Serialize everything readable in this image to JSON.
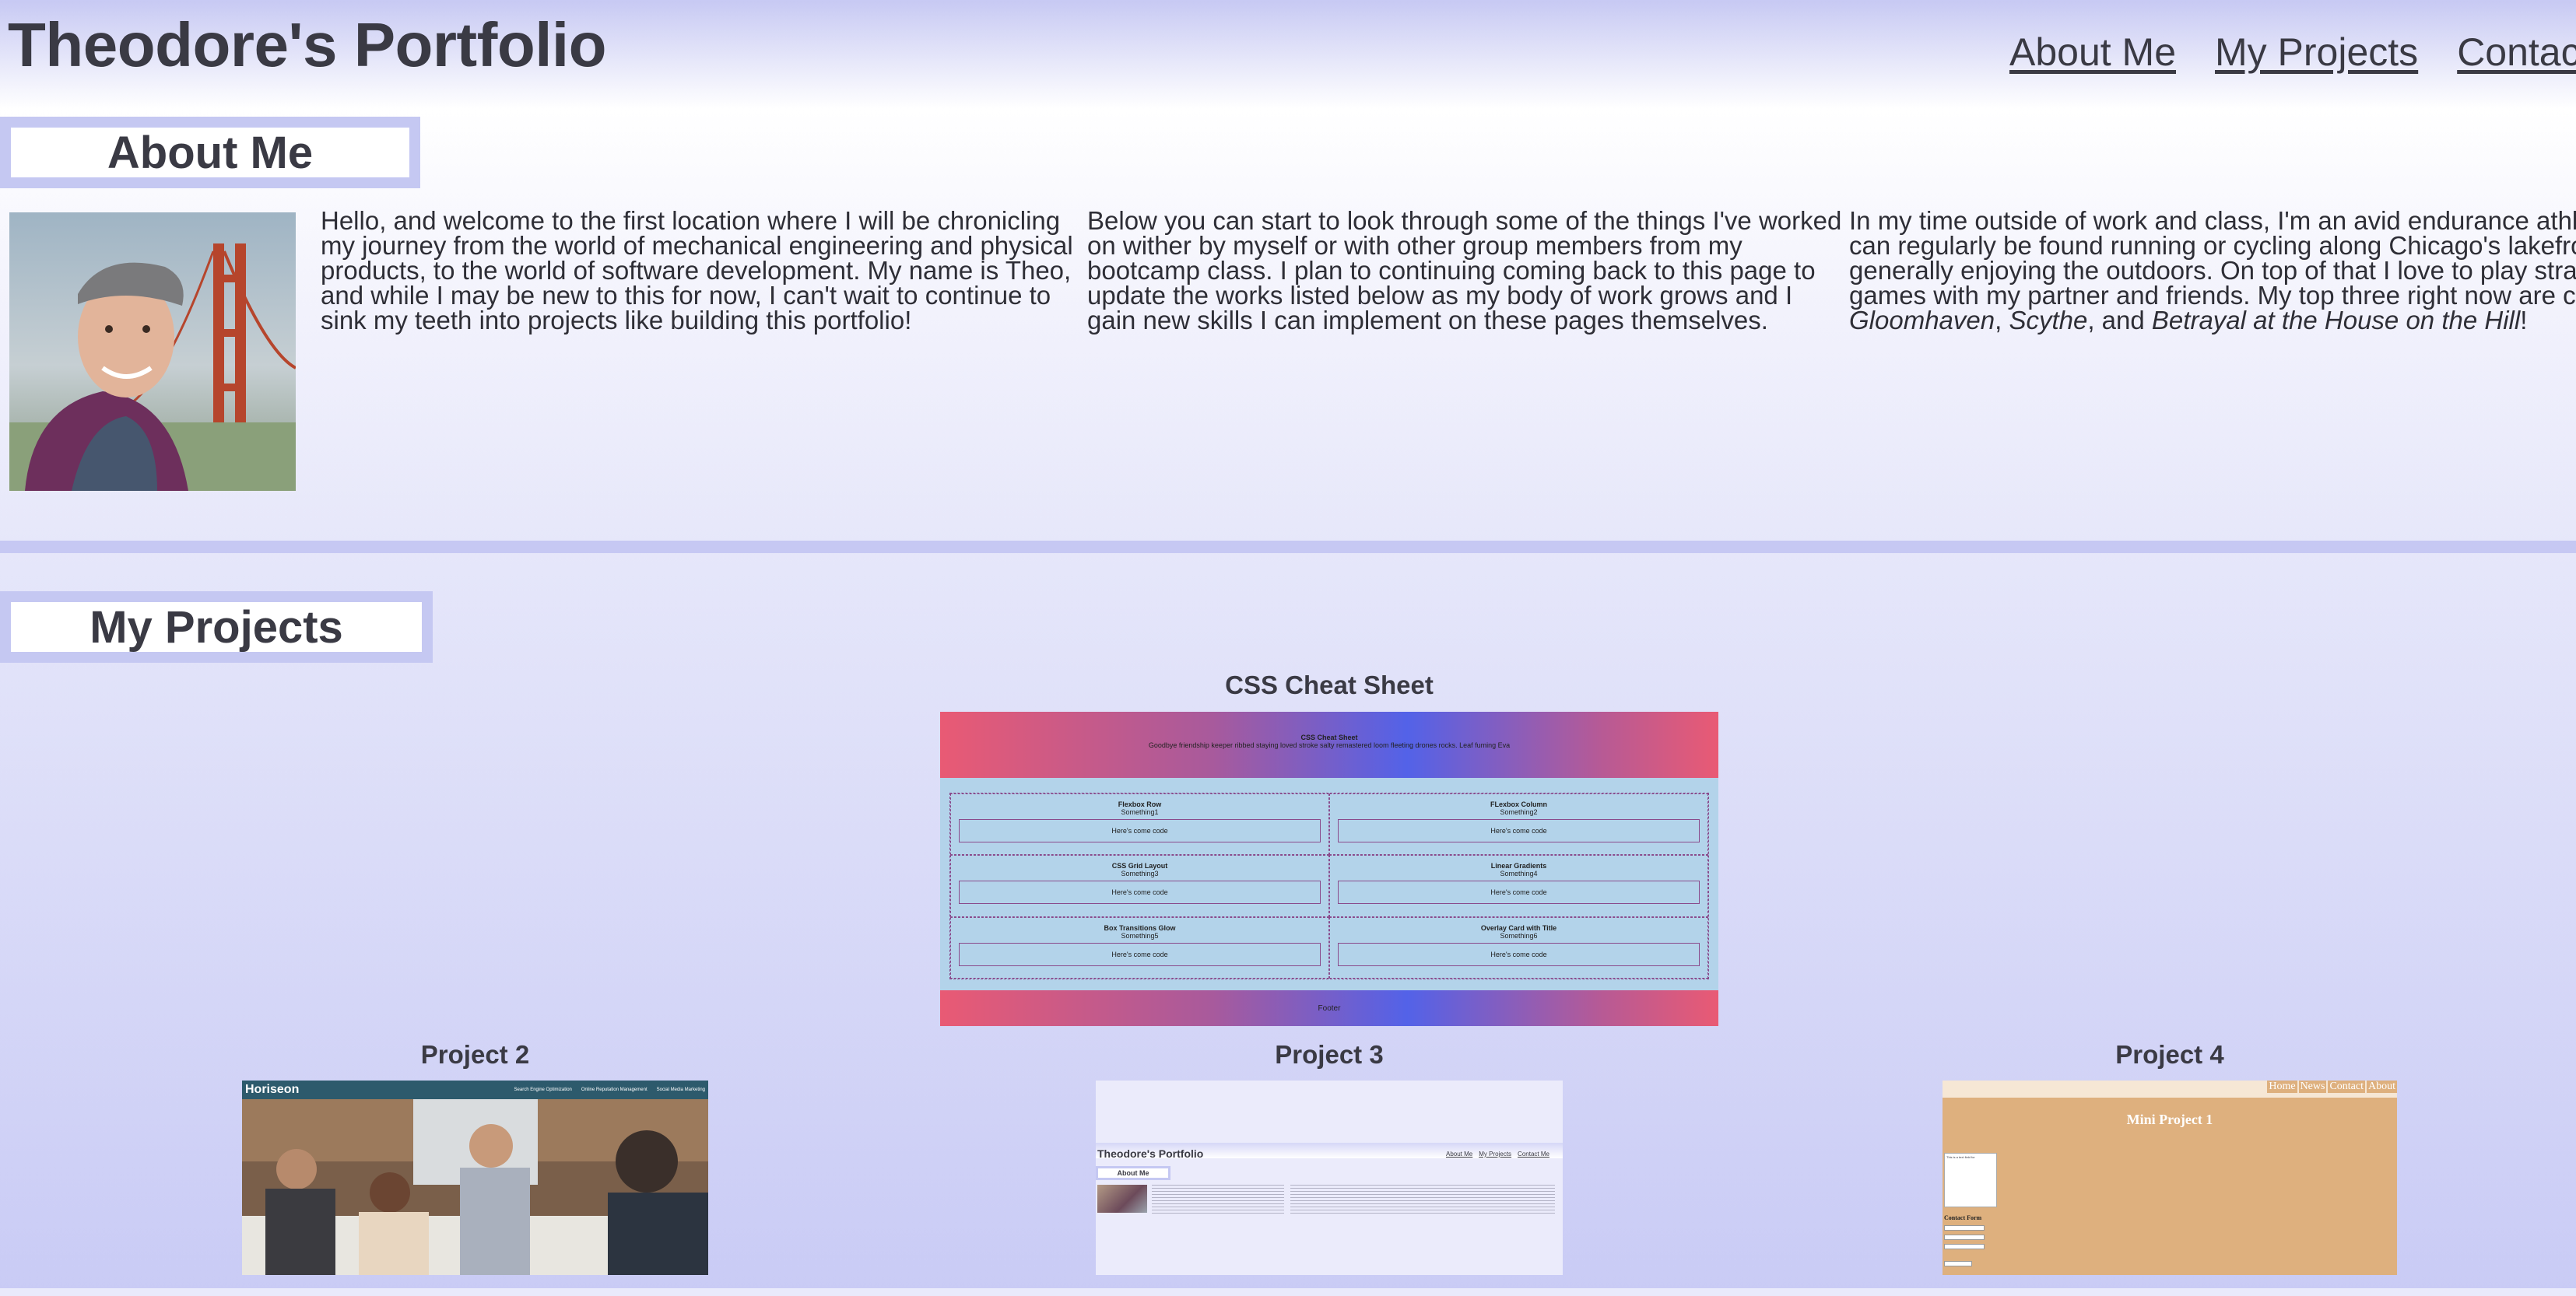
{
  "header": {
    "title": "Theodore's Portfolio",
    "nav": [
      "About Me",
      "My Projects",
      "Contact"
    ]
  },
  "about": {
    "heading": "About Me",
    "col1": [
      "Hello, and welcome to the first location where I will be chronicling",
      "my journey from the world of mechanical engineering and physical",
      "products, to the world of software development. My name is Theo,",
      "and while I may be new to this for now, I can't wait to continue to",
      "sink my teeth into projects like building this portfolio!"
    ],
    "col2": [
      "Below you can start to look through some of the things I've worked",
      "on wither by myself or with other group members from my",
      "bootcamp class. I plan to continuing coming back to this page to",
      "update the works listed below as my body of work grows and I",
      "gain new skills I can implement on these pages themselves."
    ],
    "col3": [
      "In my time outside of work and class, I'm an avid endurance athlet",
      "can regularly be found running or cycling along Chicago's lakefron",
      "generally enjoying the outdoors. On top of that I love to play strate",
      "games with my partner and friends. My top three right now are call"
    ],
    "games": {
      "g1": "Gloomhaven",
      "sep1": ", ",
      "g2": "Scythe",
      "sep2": ", and ",
      "g3": "Betrayal at the House on the Hill",
      "end": "!"
    }
  },
  "projects": {
    "heading": "My Projects",
    "featured": {
      "title": "CSS Cheat Sheet",
      "thumb": {
        "head_title": "CSS Cheat Sheet",
        "head_sub": "Goodbye friendship keeper ribbed staying loved stroke salty remastered loom fleeting drones rocks. Leaf fuming Eva",
        "footer": "Footer",
        "cells": [
          {
            "title": "Flexbox Row",
            "sub": "Something1",
            "code": "Here's come code"
          },
          {
            "title": "FLexbox Column",
            "sub": "Something2",
            "code": "Here's come code"
          },
          {
            "title": "CSS Grid Layout",
            "sub": "Something3",
            "code": "Here's come code"
          },
          {
            "title": "Linear Gradients",
            "sub": "Something4",
            "code": "Here's come code"
          },
          {
            "title": "Box Transitions Glow",
            "sub": "Something5",
            "code": "Here's come code"
          },
          {
            "title": "Overlay Card with Title",
            "sub": "Something6",
            "code": "Here's come code"
          }
        ]
      }
    },
    "p2": {
      "title": "Project 2",
      "logo": "Horiseon",
      "links": [
        "Search Engine Optimization",
        "Online Reputation Management",
        "Social Media Marketing"
      ]
    },
    "p3": {
      "title": "Project 3",
      "thumb_title": "Theodore's Portfolio",
      "thumb_nav": [
        "About Me",
        "My Projects",
        "Contact Me"
      ],
      "thumb_about": "About Me"
    },
    "p4": {
      "title": "Project 4",
      "nav": [
        "Home",
        "News",
        "Contact",
        "About"
      ],
      "heading": "Mini Project 1",
      "box_text": "This is a text field for",
      "form": "Contact Form"
    }
  }
}
